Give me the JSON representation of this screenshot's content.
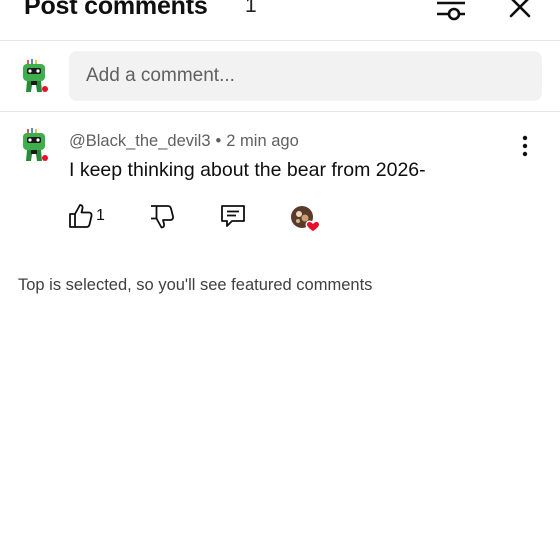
{
  "header": {
    "title": "Post comments",
    "count": "1",
    "filter_icon": "sliders-icon",
    "close_icon": "close-icon"
  },
  "composer": {
    "placeholder": "Add a comment..."
  },
  "comments": [
    {
      "author": "@Black_the_devil3",
      "separator": "•",
      "time": "2 min ago",
      "text": "I keep thinking about the bear from 2026-",
      "like_count": "1"
    }
  ],
  "footer_note": "Top is selected, so you'll see featured comments",
  "colors": {
    "text_primary": "#0f0f0f",
    "text_secondary": "#606060",
    "input_bg": "#f2f2f2",
    "divider": "#e5e5e5",
    "heart": "#e8112d",
    "avatar_green": "#3fae4c"
  }
}
